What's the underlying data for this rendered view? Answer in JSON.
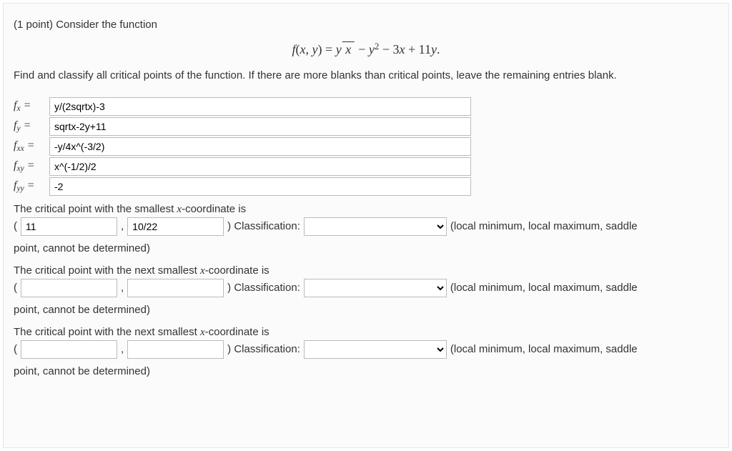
{
  "header": {
    "points_prefix": "(1 point) ",
    "prompt1": "Consider the function",
    "equation_html": "<span class='math'>f</span>(<span class='math'>x</span>, <span class='math'>y</span>) = <span class='math'>y</span><span class='sqrt'>&nbsp;<span class='math'>x</span>&nbsp;</span> − <span class='math'>y</span><span class='sup'>2</span> − 3<span class='math'>x</span> + 11<span class='math'>y</span>.",
    "prompt2": "Find and classify all critical points of the function. If there are more blanks than critical points, leave the remaining entries blank."
  },
  "derivs": {
    "fx": {
      "label_html": "<span class='math'>f<span class='sub'>x</span></span>&nbsp;=",
      "value": "y/(2sqrtx)-3"
    },
    "fy": {
      "label_html": "<span class='math'>f<span class='sub'>y</span></span>&nbsp;=",
      "value": "sqrtx-2y+11"
    },
    "fxx": {
      "label_html": "<span class='math'>f<span class='sub'>xx</span></span>&nbsp;=",
      "value": "-y/4x^(-3/2)"
    },
    "fxy": {
      "label_html": "<span class='math'>f<span class='sub'>xy</span></span>&nbsp;=",
      "value": "x^(-1/2)/2"
    },
    "fyy": {
      "label_html": "<span class='math'>f<span class='sub'>yy</span></span>&nbsp;=",
      "value": "-2"
    }
  },
  "cp_common": {
    "open": "(",
    "comma": ",",
    "close_classify": ") Classification:",
    "hint": "(local minimum, local maximum, saddle",
    "hint_line2": "point, cannot be determined)",
    "select_placeholder": ""
  },
  "critical_points": [
    {
      "intro_html": "The critical point with the smallest <span class='math'>x</span>-coordinate is",
      "x": "11",
      "y": "10/22",
      "classification": ""
    },
    {
      "intro_html": "The critical point with the next smallest <span class='math'>x</span>-coordinate is",
      "x": "",
      "y": "",
      "classification": ""
    },
    {
      "intro_html": "The critical point with the next smallest <span class='math'>x</span>-coordinate is",
      "x": "",
      "y": "",
      "classification": ""
    }
  ]
}
